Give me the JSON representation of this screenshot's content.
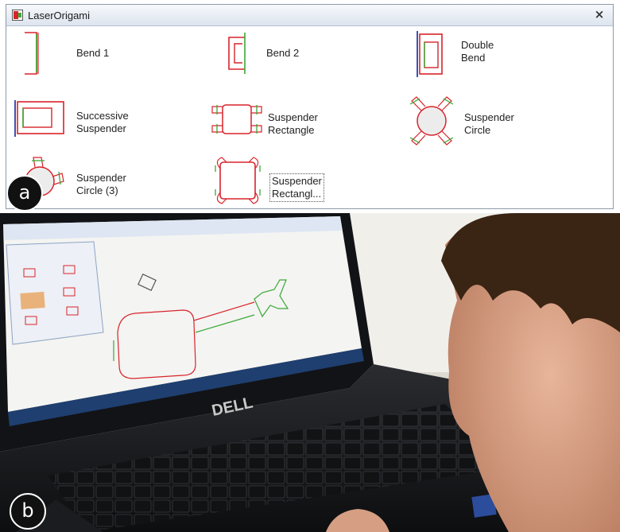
{
  "panel_a": {
    "badge": "a",
    "window": {
      "title": "LaserOrigami",
      "close_glyph": "×",
      "icon": "laserorigami-app-icon"
    },
    "tools": [
      {
        "label_lines": [
          "Bend 1"
        ],
        "icon": "bend-1-icon"
      },
      {
        "label_lines": [
          "Bend 2"
        ],
        "icon": "bend-2-icon"
      },
      {
        "label_lines": [
          "Double",
          "Bend"
        ],
        "icon": "double-bend-icon"
      },
      {
        "label_lines": [
          "Successive",
          "Suspender"
        ],
        "icon": "successive-suspender-icon"
      },
      {
        "label_lines": [
          "Suspender",
          "Rectangle"
        ],
        "icon": "suspender-rectangle-icon"
      },
      {
        "label_lines": [
          "Suspender",
          "Circle"
        ],
        "icon": "suspender-circle-icon"
      },
      {
        "label_lines": [
          "Suspender",
          "Circle (3)"
        ],
        "icon": "suspender-circle-3-icon"
      },
      {
        "label_lines": [
          "Suspender",
          "Rectangl..."
        ],
        "icon": "suspender-rectangle-2-icon",
        "selected": true
      }
    ]
  },
  "panel_b": {
    "badge": "b",
    "laptop_brand": "DELL",
    "colors": {
      "line_red": "#d9232b",
      "line_green": "#3aa935",
      "line_blue": "#2b3fa8"
    }
  }
}
